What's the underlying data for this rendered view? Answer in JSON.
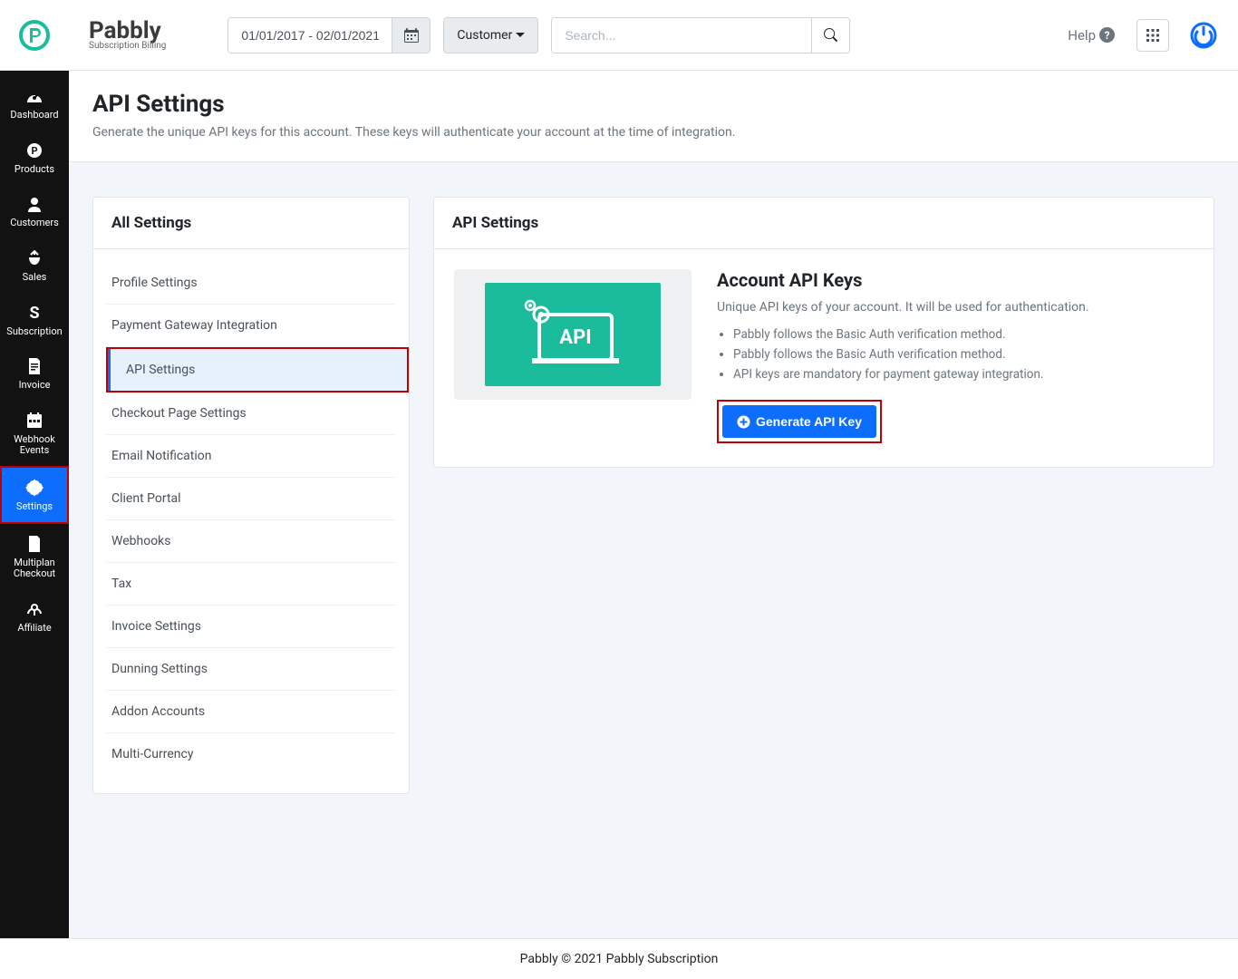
{
  "brand": {
    "name": "Pabbly",
    "tagline": "Subscription Billing"
  },
  "topbar": {
    "date_range": "01/01/2017 - 02/01/2021",
    "customer_label": "Customer",
    "search_placeholder": "Search...",
    "help_label": "Help"
  },
  "sidebar": {
    "items": [
      {
        "label": "Dashboard"
      },
      {
        "label": "Products"
      },
      {
        "label": "Customers"
      },
      {
        "label": "Sales"
      },
      {
        "label": "Subscription"
      },
      {
        "label": "Invoice"
      },
      {
        "label": "Webhook Events"
      },
      {
        "label": "Settings"
      },
      {
        "label": "Multiplan Checkout"
      },
      {
        "label": "Affiliate"
      }
    ]
  },
  "page": {
    "title": "API Settings",
    "description": "Generate the unique API keys for this account. These keys will authenticate your account at the time of integration."
  },
  "all_settings": {
    "heading": "All Settings",
    "items": [
      "Profile Settings",
      "Payment Gateway Integration",
      "API Settings",
      "Checkout Page Settings",
      "Email Notification",
      "Client Portal",
      "Webhooks",
      "Tax",
      "Invoice Settings",
      "Dunning Settings",
      "Addon Accounts",
      "Multi-Currency"
    ]
  },
  "api_card": {
    "heading": "API Settings",
    "title": "Account API Keys",
    "subtitle": "Unique API keys of your account. It will be used for authentication.",
    "bullets": [
      "Pabbly follows the Basic Auth verification method.",
      "Pabbly follows the Basic Auth verification method.",
      "API keys are mandatory for payment gateway integration."
    ],
    "button_label": "Generate API Key",
    "badge_text": "API"
  },
  "footer": {
    "text": "Pabbly © 2021 Pabbly Subscription"
  }
}
